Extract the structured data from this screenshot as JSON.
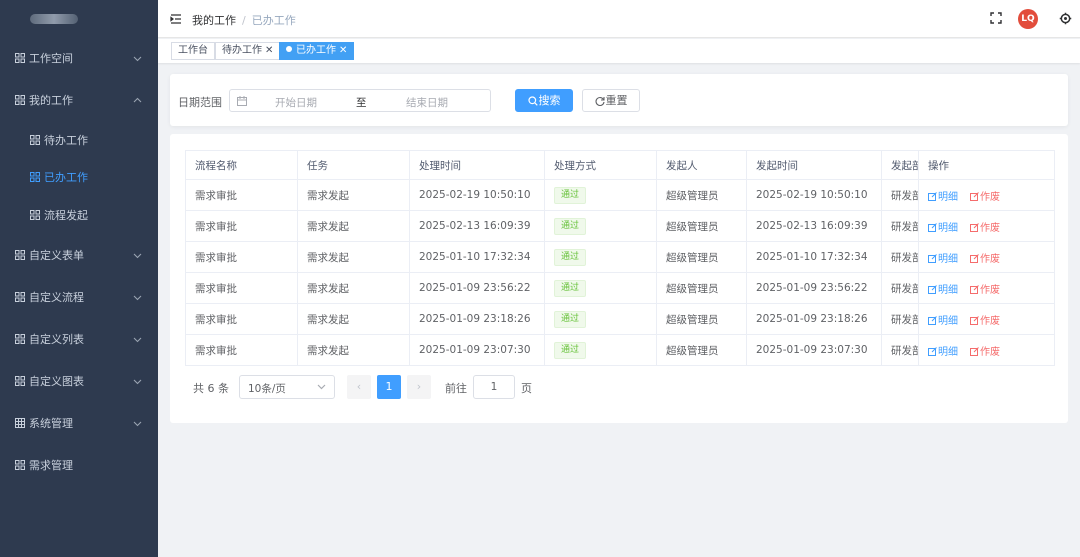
{
  "sidebar": {
    "items": [
      {
        "label": "工作空间",
        "icon": "grid-icon",
        "arrow": "down"
      },
      {
        "label": "我的工作",
        "icon": "grid-icon",
        "arrow": "up"
      },
      {
        "label": "待办工作",
        "icon": "grid-icon",
        "sub": true
      },
      {
        "label": "已办工作",
        "icon": "grid-icon",
        "sub": true,
        "active": true
      },
      {
        "label": "流程发起",
        "icon": "grid-icon",
        "sub": true
      },
      {
        "label": "自定义表单",
        "icon": "grid-icon",
        "arrow": "down"
      },
      {
        "label": "自定义流程",
        "icon": "grid-icon",
        "arrow": "down"
      },
      {
        "label": "自定义列表",
        "icon": "grid-icon",
        "arrow": "down"
      },
      {
        "label": "自定义图表",
        "icon": "grid-icon",
        "arrow": "down"
      },
      {
        "label": "系统管理",
        "icon": "table-icon",
        "arrow": "down"
      },
      {
        "label": "需求管理",
        "icon": "grid-icon"
      }
    ]
  },
  "header": {
    "breadcrumb_parent": "我的工作",
    "breadcrumb_sep": "/",
    "breadcrumb_current": "已办工作",
    "avatar_text": "LQ"
  },
  "tags": [
    {
      "label": "工作台",
      "closable": false,
      "active": false
    },
    {
      "label": "待办工作",
      "closable": true,
      "active": false
    },
    {
      "label": "已办工作",
      "closable": true,
      "active": true
    }
  ],
  "search": {
    "date_label": "日期范围",
    "start_placeholder": "开始日期",
    "range_separator": "至",
    "end_placeholder": "结束日期",
    "search_button": "搜索",
    "reset_button": "重置"
  },
  "table": {
    "columns": [
      "流程名称",
      "任务",
      "处理时间",
      "处理方式",
      "发起人",
      "发起时间",
      "发起部门",
      "操作"
    ],
    "rows": [
      {
        "name": "需求审批",
        "task": "需求发起",
        "handle_time": "2025-02-19 10:50:10",
        "method": "通过",
        "initiator": "超级管理员",
        "start_time": "2025-02-19 10:50:10",
        "dept": "研发部"
      },
      {
        "name": "需求审批",
        "task": "需求发起",
        "handle_time": "2025-02-13 16:09:39",
        "method": "通过",
        "initiator": "超级管理员",
        "start_time": "2025-02-13 16:09:39",
        "dept": "研发部"
      },
      {
        "name": "需求审批",
        "task": "需求发起",
        "handle_time": "2025-01-10 17:32:34",
        "method": "通过",
        "initiator": "超级管理员",
        "start_time": "2025-01-10 17:32:34",
        "dept": "研发部"
      },
      {
        "name": "需求审批",
        "task": "需求发起",
        "handle_time": "2025-01-09 23:56:22",
        "method": "通过",
        "initiator": "超级管理员",
        "start_time": "2025-01-09 23:56:22",
        "dept": "研发部"
      },
      {
        "name": "需求审批",
        "task": "需求发起",
        "handle_time": "2025-01-09 23:18:26",
        "method": "通过",
        "initiator": "超级管理员",
        "start_time": "2025-01-09 23:18:26",
        "dept": "研发部"
      },
      {
        "name": "需求审批",
        "task": "需求发起",
        "handle_time": "2025-01-09 23:07:30",
        "method": "通过",
        "initiator": "超级管理员",
        "start_time": "2025-01-09 23:07:30",
        "dept": "研发部"
      }
    ],
    "action_detail": "明细",
    "action_void": "作废"
  },
  "pagination": {
    "total_text": "共 6 条",
    "page_size": "10条/页",
    "current_page": "1",
    "goto_label": "前往",
    "goto_value": "1",
    "goto_unit": "页"
  },
  "colors": {
    "sidebar_bg": "#2e3a4f",
    "primary": "#409eff",
    "success": "#67c23a",
    "danger": "#f56c6c",
    "avatar": "#e24d3c"
  }
}
